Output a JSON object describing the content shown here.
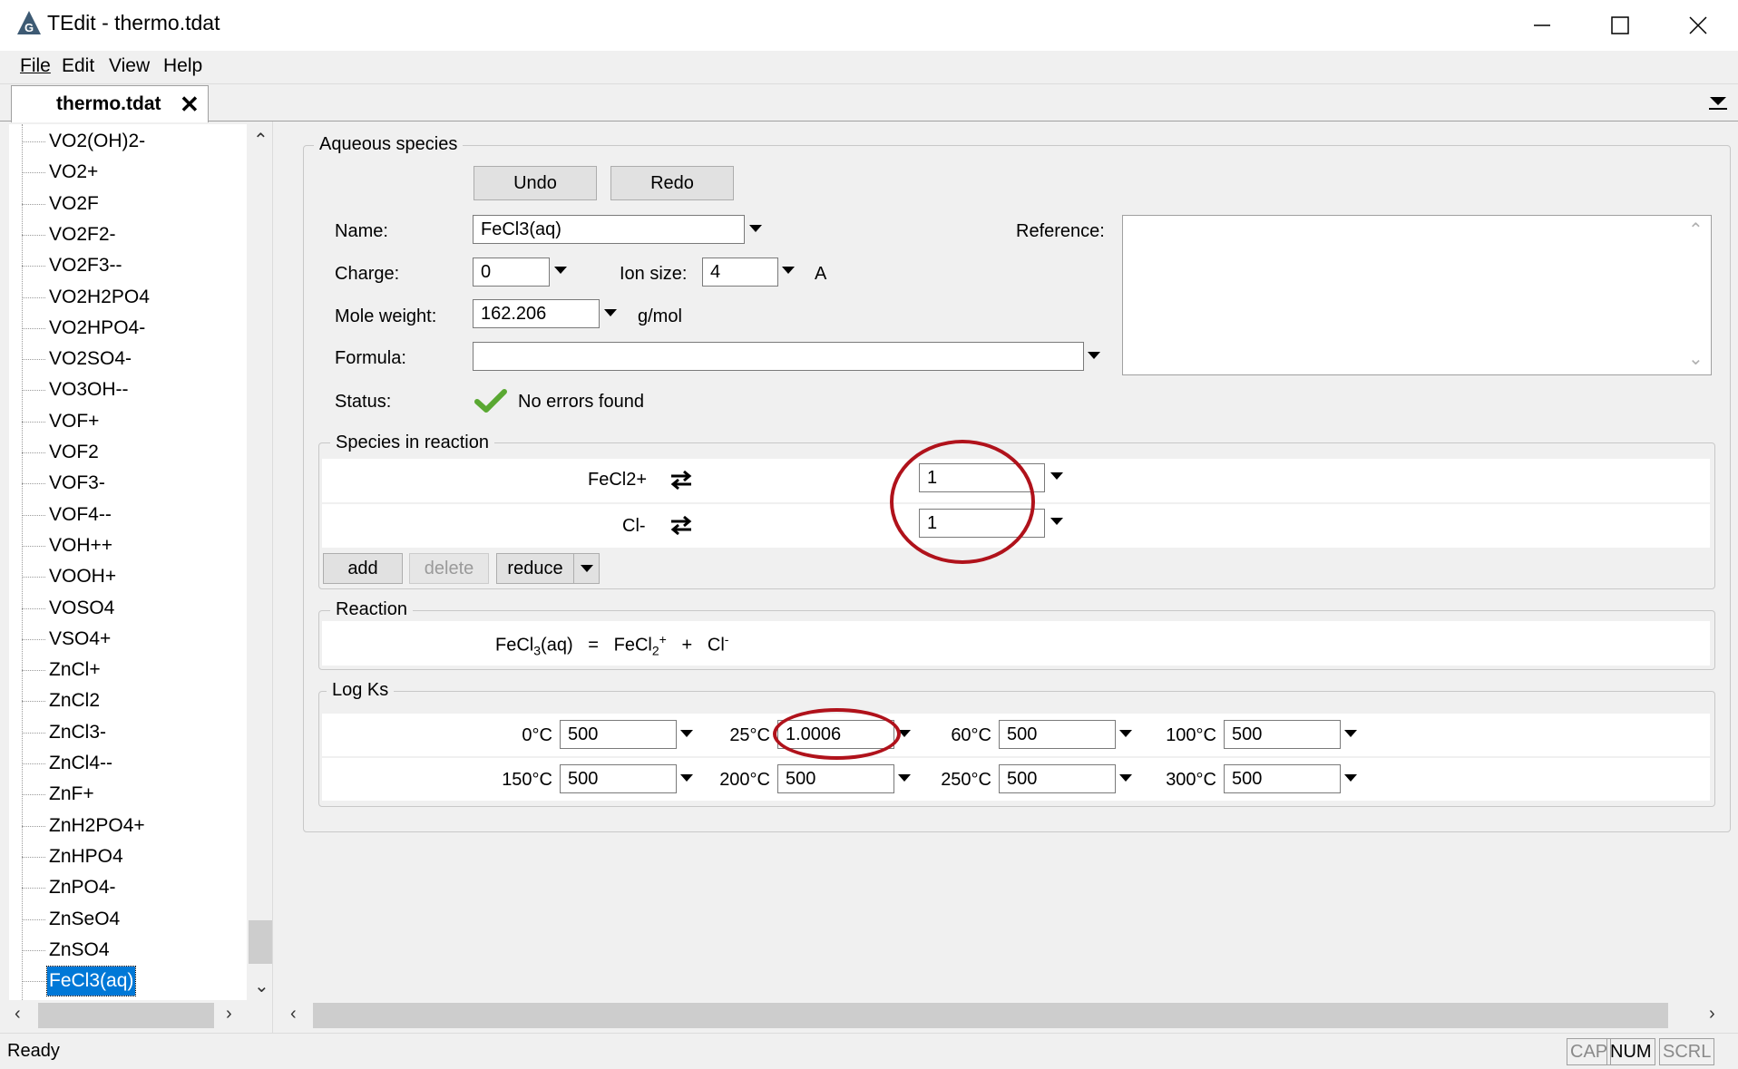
{
  "window": {
    "title": "TEdit - thermo.tdat"
  },
  "menu": {
    "file": "File",
    "edit": "Edit",
    "view": "View",
    "help": "Help"
  },
  "tab": {
    "label": "thermo.tdat",
    "close": "✕"
  },
  "tree": {
    "items": [
      "VO2(OH)2-",
      "VO2+",
      "VO2F",
      "VO2F2-",
      "VO2F3--",
      "VO2H2PO4",
      "VO2HPO4-",
      "VO2SO4-",
      "VO3OH--",
      "VOF+",
      "VOF2",
      "VOF3-",
      "VOF4--",
      "VOH++",
      "VOOH+",
      "VOSO4",
      "VSO4+",
      "ZnCl+",
      "ZnCl2",
      "ZnCl3-",
      "ZnCl4--",
      "ZnF+",
      "ZnH2PO4+",
      "ZnHPO4",
      "ZnPO4-",
      "ZnSeO4",
      "ZnSO4",
      "FeCl3(aq)"
    ],
    "selected": "FeCl3(aq)"
  },
  "aqueous": {
    "group_title": "Aqueous species",
    "undo": "Undo",
    "redo": "Redo",
    "name_label": "Name:",
    "name_value": "FeCl3(aq)",
    "charge_label": "Charge:",
    "charge_value": "0",
    "ion_size_label": "Ion size:",
    "ion_size_value": "4",
    "ion_size_unit": "A",
    "mole_weight_label": "Mole weight:",
    "mole_weight_value": "162.206",
    "mole_weight_unit": "g/mol",
    "formula_label": "Formula:",
    "formula_value": "",
    "reference_label": "Reference:",
    "reference_value": "",
    "status_label": "Status:",
    "status_text": "No errors found",
    "status_icon": "check-icon",
    "status_color": "#5aa832"
  },
  "species_in_reaction": {
    "group_title": "Species in reaction",
    "rows": [
      {
        "species": "FeCl2+",
        "coefficient": "1"
      },
      {
        "species": "Cl-",
        "coefficient": "1"
      }
    ],
    "add": "add",
    "delete": "delete",
    "reduce": "reduce"
  },
  "reaction": {
    "group_title": "Reaction",
    "lhs_base": "FeCl",
    "lhs_sub": "3",
    "lhs_suffix": "(aq)",
    "eq": "=",
    "p1_base": "FeCl",
    "p1_sub": "2",
    "p1_sup": "+",
    "plus": "+",
    "p2_base": "Cl",
    "p2_sup": "-"
  },
  "logks": {
    "group_title": "Log Ks",
    "row1": [
      {
        "temp": "0°C",
        "value": "500"
      },
      {
        "temp": "25°C",
        "value": "1.0006"
      },
      {
        "temp": "60°C",
        "value": "500"
      },
      {
        "temp": "100°C",
        "value": "500"
      }
    ],
    "row2": [
      {
        "temp": "150°C",
        "value": "500"
      },
      {
        "temp": "200°C",
        "value": "500"
      },
      {
        "temp": "250°C",
        "value": "500"
      },
      {
        "temp": "300°C",
        "value": "500"
      }
    ]
  },
  "annotation_color": "#b0121b",
  "statusbar": {
    "text": "Ready",
    "cap": "CAP",
    "num": "NUM",
    "scrl": "SCRL"
  }
}
